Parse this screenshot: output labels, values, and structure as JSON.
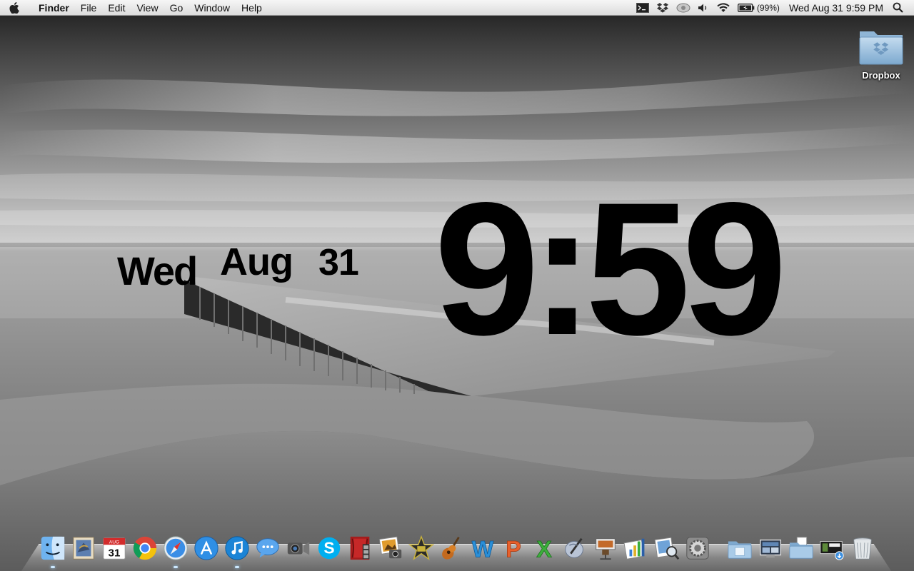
{
  "menubar": {
    "app_name": "Finder",
    "menus": [
      "File",
      "Edit",
      "View",
      "Go",
      "Window",
      "Help"
    ],
    "battery_percent": "(99%)",
    "datetime": "Wed Aug 31  9:59 PM"
  },
  "desktop": {
    "icons": [
      {
        "label": "Dropbox",
        "icon": "dropbox-folder-icon"
      }
    ]
  },
  "clock_widget": {
    "time": "9:59",
    "day": "Wed",
    "month": "Aug",
    "date": "31"
  },
  "dock": {
    "apps": [
      {
        "name": "Finder",
        "icon": "finder-icon",
        "running": true
      },
      {
        "name": "Mail",
        "icon": "mail-icon",
        "running": false
      },
      {
        "name": "iCal",
        "icon": "calendar-icon",
        "running": false,
        "badge_text": "31",
        "month_text": "AUG"
      },
      {
        "name": "Google Chrome",
        "icon": "chrome-icon",
        "running": false
      },
      {
        "name": "Safari",
        "icon": "safari-icon",
        "running": true
      },
      {
        "name": "App Store",
        "icon": "app-store-icon",
        "running": false
      },
      {
        "name": "iTunes",
        "icon": "itunes-icon",
        "running": true
      },
      {
        "name": "iChat",
        "icon": "ichat-icon",
        "running": false
      },
      {
        "name": "FaceTime",
        "icon": "facetime-icon",
        "running": false
      },
      {
        "name": "Skype",
        "icon": "skype-icon",
        "running": false
      },
      {
        "name": "Photo Booth",
        "icon": "photo-booth-icon",
        "running": false
      },
      {
        "name": "iPhoto",
        "icon": "iphoto-icon",
        "running": false
      },
      {
        "name": "iMovie",
        "icon": "imovie-icon",
        "running": false
      },
      {
        "name": "GarageBand",
        "icon": "garageband-icon",
        "running": false
      },
      {
        "name": "Word",
        "icon": "word-icon",
        "running": false,
        "glyph": "W"
      },
      {
        "name": "PowerPoint",
        "icon": "powerpoint-icon",
        "running": false,
        "glyph": "P"
      },
      {
        "name": "Excel",
        "icon": "excel-icon",
        "running": false,
        "glyph": "X"
      },
      {
        "name": "Script Editor",
        "icon": "script-editor-icon",
        "running": false
      },
      {
        "name": "Keynote",
        "icon": "keynote-icon",
        "running": false
      },
      {
        "name": "Numbers",
        "icon": "numbers-icon",
        "running": false
      },
      {
        "name": "Preview",
        "icon": "preview-icon",
        "running": false
      },
      {
        "name": "System Preferences",
        "icon": "system-preferences-icon",
        "running": false
      }
    ],
    "stacks": [
      {
        "name": "Applications",
        "icon": "applications-folder-icon"
      },
      {
        "name": "Screenshots",
        "icon": "screenshots-stack-icon"
      },
      {
        "name": "Documents",
        "icon": "documents-folder-icon"
      },
      {
        "name": "Downloads",
        "icon": "downloads-stack-icon"
      },
      {
        "name": "Trash",
        "icon": "trash-icon"
      }
    ]
  }
}
